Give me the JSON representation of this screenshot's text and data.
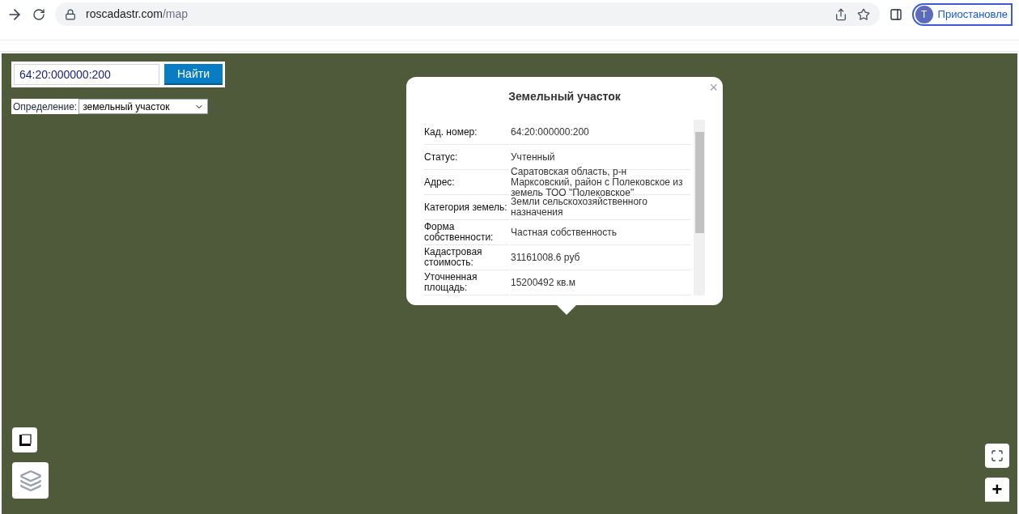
{
  "browser": {
    "url_host": "roscadastr.com",
    "url_path": "/map",
    "profile_initial": "T",
    "profile_label": "Приостановле"
  },
  "search": {
    "value": "64:20:000000:200",
    "button": "Найти"
  },
  "definition": {
    "label": "Определение:",
    "value": "земельный участок"
  },
  "popup": {
    "title": "Земельный участок",
    "close": "×",
    "rows": [
      {
        "label": "Кад. номер:",
        "value": "64:20:000000:200"
      },
      {
        "label": "Статус:",
        "value": "Учтенный"
      },
      {
        "label": "Адрес:",
        "value": "Саратовская область, р-н Марксовский, район с Полековское из земель ТОО \"Полековское\""
      },
      {
        "label": "Категория земель:",
        "value": "Земли сельскохозяйственного назначения"
      },
      {
        "label": "Форма собственности:",
        "value": "Частная собственность"
      },
      {
        "label": "Кадастровая стоимость:",
        "value": "31161008.6 руб"
      },
      {
        "label": "Уточненная площадь:",
        "value": "15200492 кв.м"
      }
    ]
  },
  "zoom": {
    "in": "+"
  }
}
